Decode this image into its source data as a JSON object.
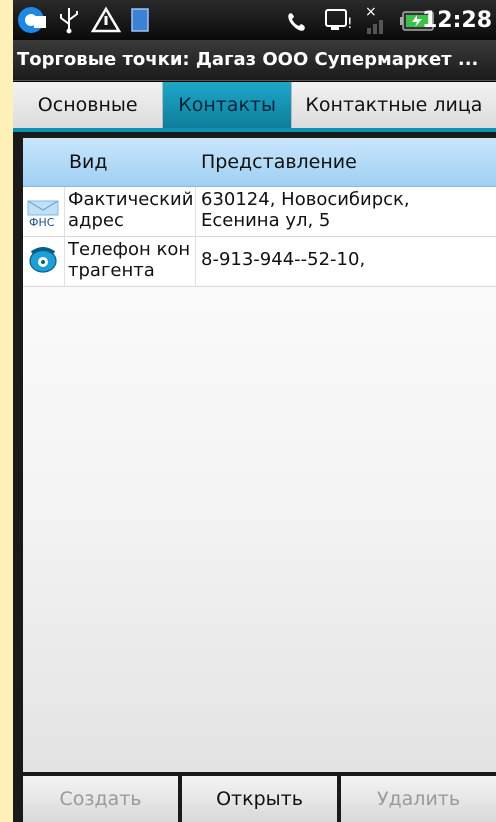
{
  "statusbar": {
    "time": "12:28",
    "icons": [
      "app-notification-icon",
      "usb-icon",
      "warning-icon",
      "sd-card-icon",
      "phone-call-icon",
      "voicemail-icon",
      "signal-off-icon",
      "battery-charging-icon"
    ]
  },
  "title": "Торговые точки: Дагаз ООО Супермаркет ...",
  "tabs": [
    {
      "label": "Основные",
      "active": false
    },
    {
      "label": "Контакты",
      "active": true
    },
    {
      "label": "Контактные лица",
      "active": false
    }
  ],
  "table": {
    "headers": [
      "Вид",
      "Представление"
    ],
    "rows": [
      {
        "icon": "fns-mail-icon",
        "icon_text": "ФНС",
        "type": "Фактический адрес",
        "value": "630124, Новосибирск, Есенина ул, 5"
      },
      {
        "icon": "telephone-icon",
        "type": "Телефон контрагента",
        "value": "8-913-944--52-10,"
      }
    ]
  },
  "buttons": {
    "create": "Создать",
    "open": "Открыть",
    "delete": "Удалить"
  },
  "colors": {
    "accent": "#1ea8c9",
    "header_blue": "#9fd0f4",
    "background_frame": "#fdf1b8"
  }
}
